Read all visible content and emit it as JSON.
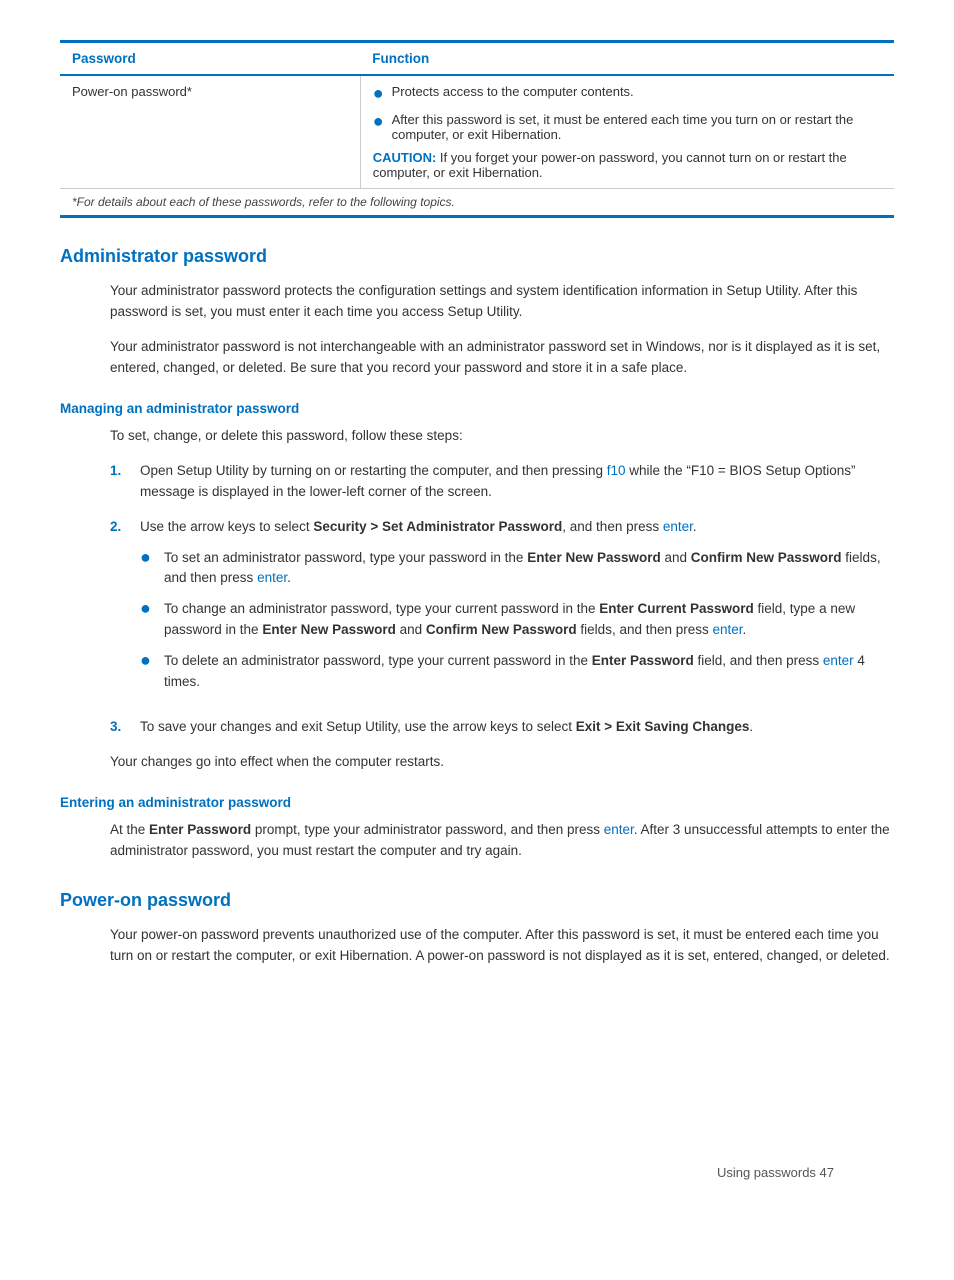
{
  "table": {
    "col1_header": "Password",
    "col2_header": "Function",
    "rows": [
      {
        "password": "Power-on password*",
        "functions": [
          "Protects access to the computer contents.",
          "After this password is set, it must be entered each time you turn on or restart the computer, or exit Hibernation."
        ],
        "caution": "If you forget your power-on password, you cannot turn on or restart the computer, or exit Hibernation."
      }
    ],
    "footnote": "*For details about each of these passwords, refer to the following topics."
  },
  "admin_password": {
    "heading": "Administrator password",
    "para1": "Your administrator password protects the configuration settings and system identification information in Setup Utility. After this password is set, you must enter it each time you access Setup Utility.",
    "para2": "Your administrator password is not interchangeable with an administrator password set in Windows, nor is it displayed as it is set, entered, changed, or deleted. Be sure that you record your password and store it in a safe place.",
    "managing": {
      "heading": "Managing an administrator password",
      "intro": "To set, change, or delete this password, follow these steps:",
      "steps": [
        {
          "num": "1.",
          "text_before": "Open Setup Utility by turning on or restarting the computer, and then pressing ",
          "link1": "f10",
          "text_middle": " while the “F10 = BIOS Setup Options” message is displayed in the lower-left corner of the screen.",
          "link2": null,
          "text_after": null,
          "sub_items": []
        },
        {
          "num": "2.",
          "text_before": "Use the arrow keys to select ",
          "bold1": "Security > Set Administrator Password",
          "text_middle": ", and then press ",
          "link1": "enter",
          "text_after": ".",
          "sub_items": [
            {
              "text_before": "To set an administrator password, type your password in the ",
              "bold1": "Enter New Password",
              "text_middle": " and ",
              "bold2": "Confirm New Password",
              "text_middle2": " fields, and then press ",
              "link1": "enter",
              "text_after": "."
            },
            {
              "text_before": "To change an administrator password, type your current password in the ",
              "bold1": "Enter Current Password",
              "text_middle": " field, type a new password in the ",
              "bold2": "Enter New Password",
              "text_middle2": " and ",
              "bold3": "Confirm New Password",
              "text_middle3": " fields, and then press ",
              "link1": "enter",
              "text_after": "."
            },
            {
              "text_before": "To delete an administrator password, type your current password in the ",
              "bold1": "Enter Password",
              "text_middle": " field, and then press ",
              "link1": "enter",
              "text_after": " 4 times."
            }
          ]
        },
        {
          "num": "3.",
          "text_before": "To save your changes and exit Setup Utility, use the arrow keys to select ",
          "bold1": "Exit > Exit Saving Changes",
          "text_after": ".",
          "sub_items": []
        }
      ],
      "closing": "Your changes go into effect when the computer restarts."
    },
    "entering": {
      "heading": "Entering an administrator password",
      "text_before": "At the ",
      "bold1": "Enter Password",
      "text_middle": " prompt, type your administrator password, and then press ",
      "link1": "enter",
      "text_after": ". After 3 unsuccessful attempts to enter the administrator password, you must restart the computer and try again."
    }
  },
  "power_on_password": {
    "heading": "Power-on password",
    "para": "Your power-on password prevents unauthorized use of the computer. After this password is set, it must be entered each time you turn on or restart the computer, or exit Hibernation. A power-on password is not displayed as it is set, entered, changed, or deleted."
  },
  "footer": {
    "text": "Using passwords    47"
  }
}
